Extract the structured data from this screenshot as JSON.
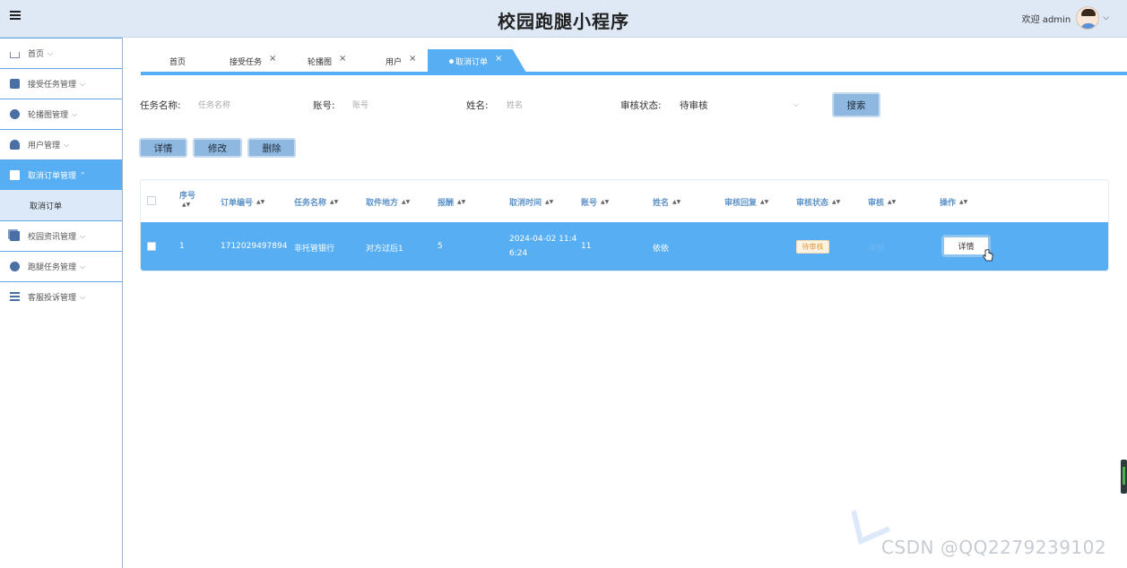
{
  "header": {
    "title": "校园跑腿小程序",
    "welcome": "欢迎 admin",
    "user_caret": "⌵"
  },
  "sidebar": {
    "items": [
      {
        "label": "首页",
        "caret": "⌵"
      },
      {
        "label": "接受任务管理",
        "caret": "⌵"
      },
      {
        "label": "轮播图管理",
        "caret": "⌵"
      },
      {
        "label": "用户管理",
        "caret": "⌵"
      },
      {
        "label": "取消订单管理",
        "caret": "⌃"
      },
      {
        "label": "校园资讯管理",
        "caret": "⌵"
      },
      {
        "label": "跑腿任务管理",
        "caret": "⌵"
      },
      {
        "label": "客服投诉管理",
        "caret": "⌵"
      }
    ],
    "sub_item": "取消订单"
  },
  "tabs": {
    "items": [
      {
        "label": "首页"
      },
      {
        "label": "接受任务",
        "close": "×"
      },
      {
        "label": "轮播图",
        "close": "×"
      },
      {
        "label": "用户",
        "close": "×"
      }
    ],
    "active": {
      "label": "取消订单",
      "close": "×"
    }
  },
  "search": {
    "task_name_label": "任务名称:",
    "task_name_placeholder": "任务名称",
    "account_label": "账号:",
    "account_placeholder": "账号",
    "name_label": "姓名:",
    "name_placeholder": "姓名",
    "status_label": "审核状态:",
    "status_value": "待审核",
    "status_caret": "⌵",
    "search_button": "搜索"
  },
  "actions": {
    "detail": "详情",
    "edit": "修改",
    "delete": "删除"
  },
  "table": {
    "sort_icon": "▲▼",
    "headers": {
      "seq_line1": "序号",
      "seq_line2": "",
      "order_no": "订单编号",
      "task_name": "任务名称",
      "pickup": "取件地方",
      "reward": "报酬",
      "cancel_time": "取消时间",
      "account": "账号",
      "name": "姓名",
      "audit_reply": "审核回复",
      "audit_status": "审核状态",
      "audit": "审核",
      "operation": "操作"
    },
    "rows": [
      {
        "seq": "1",
        "order_no": "1712029497894",
        "task_name": "非托管银行",
        "pickup": "对方过后1",
        "reward": "5",
        "cancel_time_line1": "2024-04-02 11:4",
        "cancel_time_line2": "6:24",
        "account": "11",
        "name": "依依",
        "audit_reply": "",
        "audit_status": "待审核",
        "audit": "审核",
        "operation": "详情"
      }
    ]
  },
  "watermark": "CSDN @QQ2279239102",
  "colors": {
    "accent": "#58aef3",
    "header_bg": "#dfe9f6",
    "button_bg": "#8fb8e0",
    "badge_text": "#e09a3c"
  }
}
